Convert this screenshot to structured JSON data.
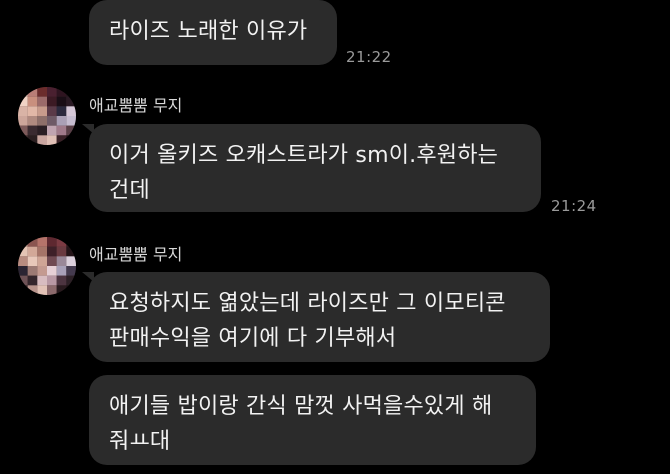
{
  "messages": [
    {
      "text": "라이즈 노래한 이유가",
      "time": "21:22"
    },
    {
      "sender": "애교뿜뿜 무지",
      "text": "이거 올키즈 오캐스트라가 sm이.후원하는\n건데",
      "time": "21:24"
    },
    {
      "sender": "애교뿜뿜 무지",
      "text": "요청하지도 엶았는데 라이즈만 그 이모티콘\n판매수익을 여기에 다 기부해서"
    },
    {
      "text": "애기들 밥이랑 간식 맘껏 사먹을수있게 해\n줘ㅛ대"
    }
  ],
  "colors": {
    "background": "#000000",
    "bubble": "#2b2b2b",
    "time": "#9a9a9a"
  },
  "icons": {
    "avatar": "pixelated-profile-avatar"
  }
}
